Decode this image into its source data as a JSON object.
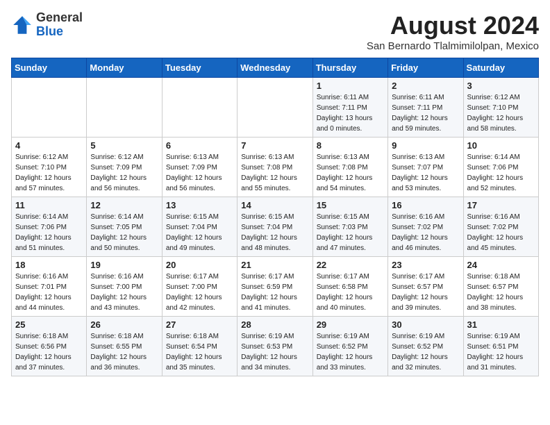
{
  "logo": {
    "general": "General",
    "blue": "Blue"
  },
  "title": "August 2024",
  "location": "San Bernardo Tlalmimilolpan, Mexico",
  "days_of_week": [
    "Sunday",
    "Monday",
    "Tuesday",
    "Wednesday",
    "Thursday",
    "Friday",
    "Saturday"
  ],
  "weeks": [
    [
      {
        "day": "",
        "info": ""
      },
      {
        "day": "",
        "info": ""
      },
      {
        "day": "",
        "info": ""
      },
      {
        "day": "",
        "info": ""
      },
      {
        "day": "1",
        "info": "Sunrise: 6:11 AM\nSunset: 7:11 PM\nDaylight: 13 hours\nand 0 minutes."
      },
      {
        "day": "2",
        "info": "Sunrise: 6:11 AM\nSunset: 7:11 PM\nDaylight: 12 hours\nand 59 minutes."
      },
      {
        "day": "3",
        "info": "Sunrise: 6:12 AM\nSunset: 7:10 PM\nDaylight: 12 hours\nand 58 minutes."
      }
    ],
    [
      {
        "day": "4",
        "info": "Sunrise: 6:12 AM\nSunset: 7:10 PM\nDaylight: 12 hours\nand 57 minutes."
      },
      {
        "day": "5",
        "info": "Sunrise: 6:12 AM\nSunset: 7:09 PM\nDaylight: 12 hours\nand 56 minutes."
      },
      {
        "day": "6",
        "info": "Sunrise: 6:13 AM\nSunset: 7:09 PM\nDaylight: 12 hours\nand 56 minutes."
      },
      {
        "day": "7",
        "info": "Sunrise: 6:13 AM\nSunset: 7:08 PM\nDaylight: 12 hours\nand 55 minutes."
      },
      {
        "day": "8",
        "info": "Sunrise: 6:13 AM\nSunset: 7:08 PM\nDaylight: 12 hours\nand 54 minutes."
      },
      {
        "day": "9",
        "info": "Sunrise: 6:13 AM\nSunset: 7:07 PM\nDaylight: 12 hours\nand 53 minutes."
      },
      {
        "day": "10",
        "info": "Sunrise: 6:14 AM\nSunset: 7:06 PM\nDaylight: 12 hours\nand 52 minutes."
      }
    ],
    [
      {
        "day": "11",
        "info": "Sunrise: 6:14 AM\nSunset: 7:06 PM\nDaylight: 12 hours\nand 51 minutes."
      },
      {
        "day": "12",
        "info": "Sunrise: 6:14 AM\nSunset: 7:05 PM\nDaylight: 12 hours\nand 50 minutes."
      },
      {
        "day": "13",
        "info": "Sunrise: 6:15 AM\nSunset: 7:04 PM\nDaylight: 12 hours\nand 49 minutes."
      },
      {
        "day": "14",
        "info": "Sunrise: 6:15 AM\nSunset: 7:04 PM\nDaylight: 12 hours\nand 48 minutes."
      },
      {
        "day": "15",
        "info": "Sunrise: 6:15 AM\nSunset: 7:03 PM\nDaylight: 12 hours\nand 47 minutes."
      },
      {
        "day": "16",
        "info": "Sunrise: 6:16 AM\nSunset: 7:02 PM\nDaylight: 12 hours\nand 46 minutes."
      },
      {
        "day": "17",
        "info": "Sunrise: 6:16 AM\nSunset: 7:02 PM\nDaylight: 12 hours\nand 45 minutes."
      }
    ],
    [
      {
        "day": "18",
        "info": "Sunrise: 6:16 AM\nSunset: 7:01 PM\nDaylight: 12 hours\nand 44 minutes."
      },
      {
        "day": "19",
        "info": "Sunrise: 6:16 AM\nSunset: 7:00 PM\nDaylight: 12 hours\nand 43 minutes."
      },
      {
        "day": "20",
        "info": "Sunrise: 6:17 AM\nSunset: 7:00 PM\nDaylight: 12 hours\nand 42 minutes."
      },
      {
        "day": "21",
        "info": "Sunrise: 6:17 AM\nSunset: 6:59 PM\nDaylight: 12 hours\nand 41 minutes."
      },
      {
        "day": "22",
        "info": "Sunrise: 6:17 AM\nSunset: 6:58 PM\nDaylight: 12 hours\nand 40 minutes."
      },
      {
        "day": "23",
        "info": "Sunrise: 6:17 AM\nSunset: 6:57 PM\nDaylight: 12 hours\nand 39 minutes."
      },
      {
        "day": "24",
        "info": "Sunrise: 6:18 AM\nSunset: 6:57 PM\nDaylight: 12 hours\nand 38 minutes."
      }
    ],
    [
      {
        "day": "25",
        "info": "Sunrise: 6:18 AM\nSunset: 6:56 PM\nDaylight: 12 hours\nand 37 minutes."
      },
      {
        "day": "26",
        "info": "Sunrise: 6:18 AM\nSunset: 6:55 PM\nDaylight: 12 hours\nand 36 minutes."
      },
      {
        "day": "27",
        "info": "Sunrise: 6:18 AM\nSunset: 6:54 PM\nDaylight: 12 hours\nand 35 minutes."
      },
      {
        "day": "28",
        "info": "Sunrise: 6:19 AM\nSunset: 6:53 PM\nDaylight: 12 hours\nand 34 minutes."
      },
      {
        "day": "29",
        "info": "Sunrise: 6:19 AM\nSunset: 6:52 PM\nDaylight: 12 hours\nand 33 minutes."
      },
      {
        "day": "30",
        "info": "Sunrise: 6:19 AM\nSunset: 6:52 PM\nDaylight: 12 hours\nand 32 minutes."
      },
      {
        "day": "31",
        "info": "Sunrise: 6:19 AM\nSunset: 6:51 PM\nDaylight: 12 hours\nand 31 minutes."
      }
    ]
  ]
}
